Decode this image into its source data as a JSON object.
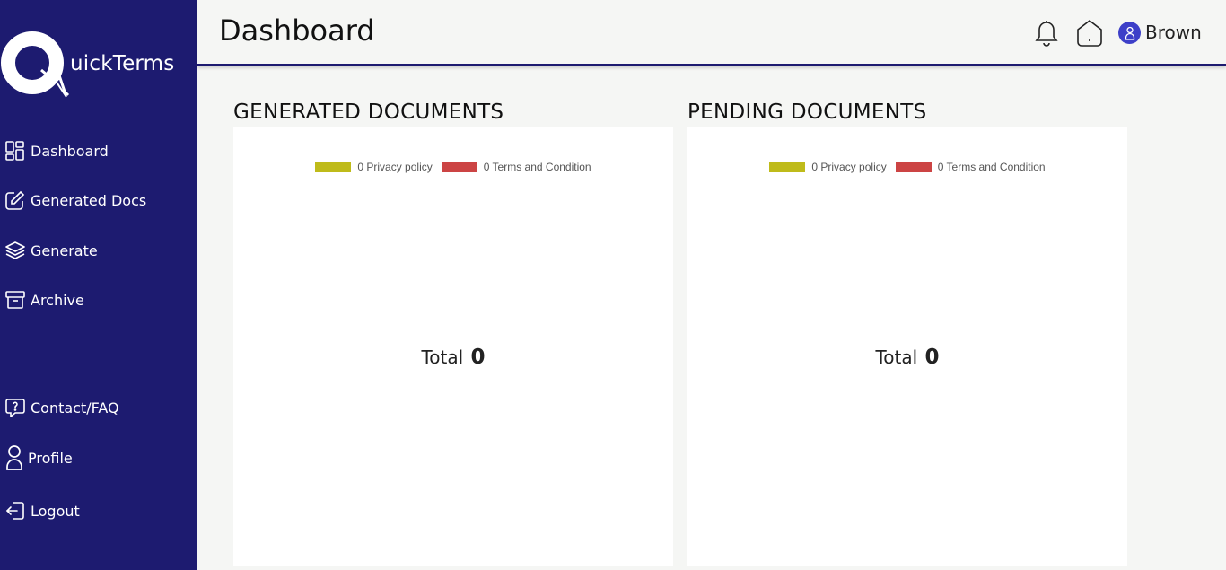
{
  "app": {
    "logo_text": "uickTerms"
  },
  "sidebar": {
    "items": [
      {
        "label": "Dashboard",
        "icon": "grid-icon"
      },
      {
        "label": "Generated Docs",
        "icon": "edit-icon"
      },
      {
        "label": "Generate",
        "icon": "layers-icon"
      },
      {
        "label": "Archive",
        "icon": "archive-icon"
      },
      {
        "label": "Contact/FAQ",
        "icon": "help-chat-icon"
      },
      {
        "label": "Profile",
        "icon": "user-icon"
      },
      {
        "label": "Logout",
        "icon": "logout-icon"
      }
    ]
  },
  "header": {
    "title": "Dashboard",
    "username": "Brown"
  },
  "colors": {
    "sidebar": "#1d1b70",
    "privacy": "#bfbb1a",
    "terms": "#cc4444",
    "avatar": "#3d3fc8"
  },
  "cards": [
    {
      "title": "GENERATED DOCUMENTS",
      "total_label": "Total",
      "total_value": "0",
      "legend": [
        {
          "label": "0 Privacy policy"
        },
        {
          "label": "0 Terms and Condition"
        }
      ]
    },
    {
      "title": "PENDING DOCUMENTS",
      "total_label": "Total",
      "total_value": "0",
      "legend": [
        {
          "label": "0 Privacy policy"
        },
        {
          "label": "0 Terms and Condition"
        }
      ]
    }
  ],
  "chart_data": [
    {
      "type": "pie",
      "categories": [
        "Privacy policy",
        "Terms and Condition"
      ],
      "values": [
        0,
        0
      ],
      "legend": "top"
    },
    {
      "type": "pie",
      "categories": [
        "Privacy policy",
        "Terms and Condition"
      ],
      "values": [
        0,
        0
      ],
      "legend": "top"
    }
  ]
}
